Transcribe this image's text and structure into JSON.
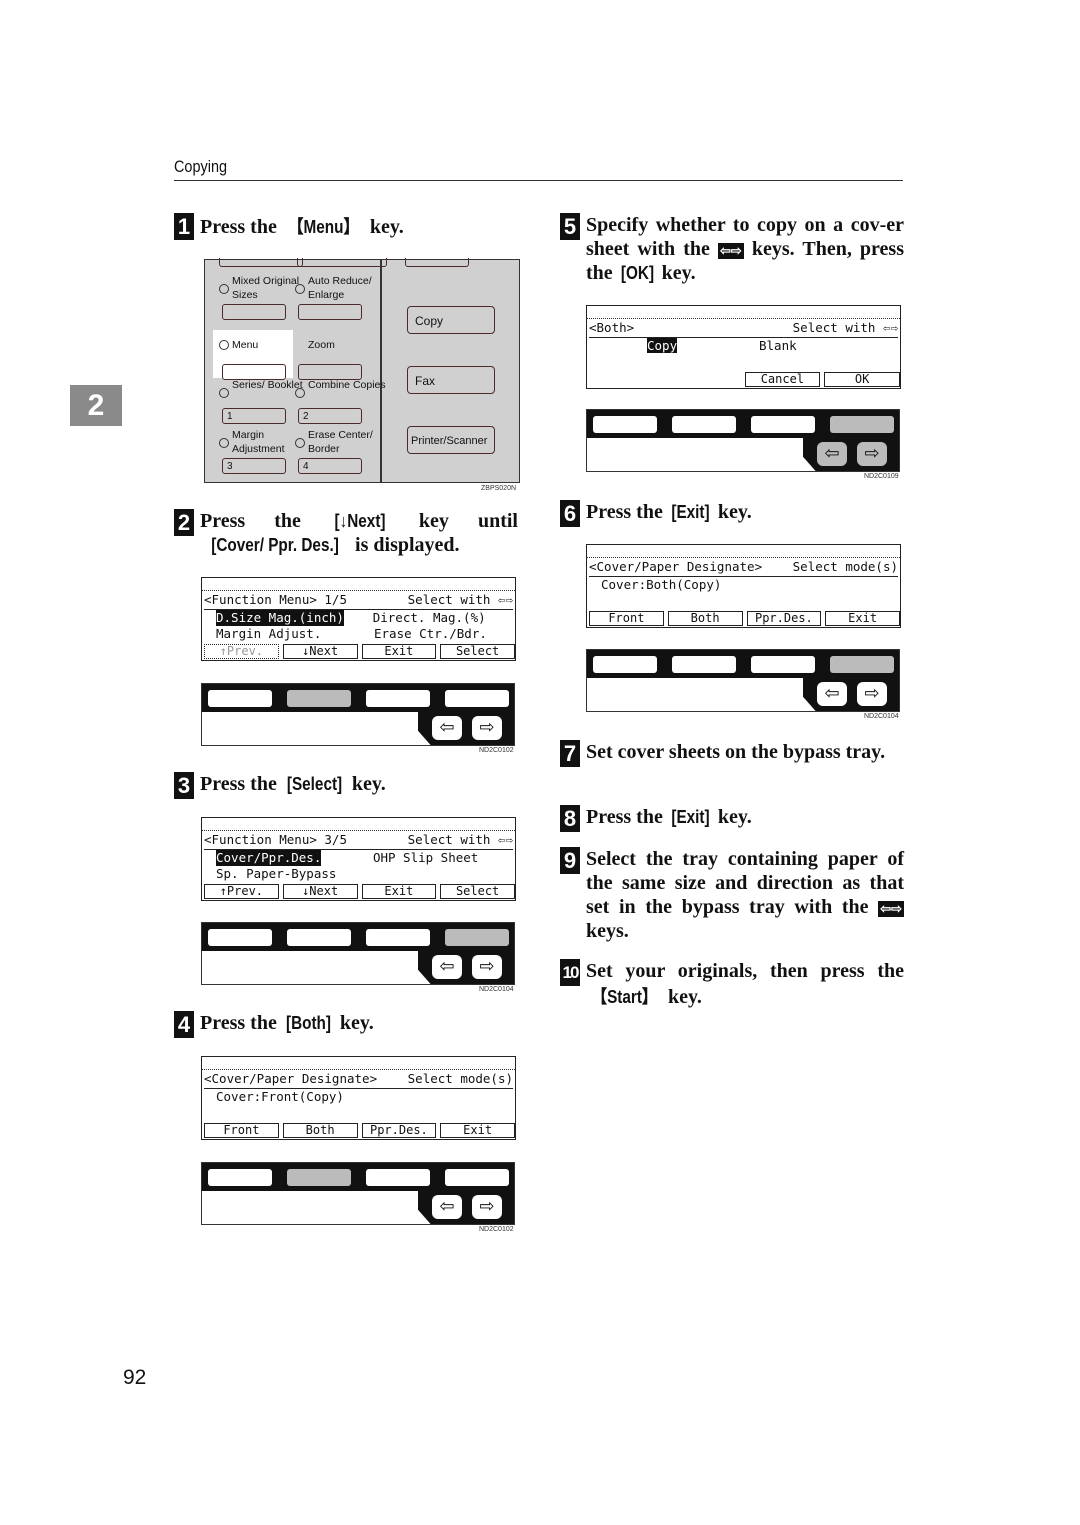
{
  "header": {
    "section": "Copying"
  },
  "chapter_tab": "2",
  "page_number": "92",
  "steps": [
    {
      "num": "1",
      "segments": [
        {
          "t": "Press the "
        },
        {
          "t": "【Menu】",
          "key": true
        },
        {
          "t": " key."
        }
      ]
    },
    {
      "num": "2",
      "segments": [
        {
          "t": "Press the "
        },
        {
          "t": "[↓Next]",
          "key": true
        },
        {
          "t": " key until "
        },
        {
          "t": "[Cover/ Ppr. Des.]",
          "key": true
        },
        {
          "t": " is displayed."
        }
      ]
    },
    {
      "num": "3",
      "segments": [
        {
          "t": "Press the "
        },
        {
          "t": "[Select]",
          "key": true
        },
        {
          "t": " key."
        }
      ]
    },
    {
      "num": "4",
      "segments": [
        {
          "t": "Press the "
        },
        {
          "t": "[Both]",
          "key": true
        },
        {
          "t": " key."
        }
      ]
    },
    {
      "num": "5",
      "segments": [
        {
          "t": "Specify whether to copy on a cov-er sheet with the "
        },
        {
          "t": "⇦⇨",
          "icon": true
        },
        {
          "t": " keys. Then, press the "
        },
        {
          "t": "[OK]",
          "key": true
        },
        {
          "t": " key."
        }
      ]
    },
    {
      "num": "6",
      "segments": [
        {
          "t": "Press the "
        },
        {
          "t": "[Exit]",
          "key": true
        },
        {
          "t": " key."
        }
      ]
    },
    {
      "num": "7",
      "segments": [
        {
          "t": "Set cover sheets on the bypass tray."
        }
      ]
    },
    {
      "num": "8",
      "segments": [
        {
          "t": "Press the "
        },
        {
          "t": "[Exit]",
          "key": true
        },
        {
          "t": " key."
        }
      ]
    },
    {
      "num": "9",
      "segments": [
        {
          "t": "Select the tray containing paper of the same size and direction as that set in the bypass tray with the "
        },
        {
          "t": "⇦⇨",
          "icon": true
        },
        {
          "t": " keys."
        }
      ]
    },
    {
      "num": "10",
      "segments": [
        {
          "t": "Set your originals, then press the "
        },
        {
          "t": "【Start】",
          "key": true
        },
        {
          "t": " key."
        }
      ]
    }
  ],
  "panel": {
    "buttons": [
      {
        "label": "Mixed Original Sizes"
      },
      {
        "label": "Auto Reduce/ Enlarge"
      },
      {
        "label": "Menu",
        "highlighted": true
      },
      {
        "label": "Zoom"
      },
      {
        "label": "Series/ Booklet",
        "key": "1"
      },
      {
        "label": "Combine Copies",
        "key": "2"
      },
      {
        "label": "Margin Adjustment",
        "key": "3"
      },
      {
        "label": "Erase Center/ Border",
        "key": "4"
      }
    ],
    "modes": [
      "Copy",
      "Fax",
      "Printer/Scanner"
    ],
    "code": "ZBPS020N"
  },
  "displays": [
    {
      "step": "2",
      "header_left": "<Function Menu> 1/5",
      "header_right": "Select with ⇦⇨",
      "rows": [
        [
          {
            "t": "D.Size Mag.(inch)",
            "hl": true
          },
          {
            "t": "Direct. Mag.(%)"
          }
        ],
        [
          {
            "t": "Margin Adjust."
          },
          {
            "t": "Erase Ctr./Bdr."
          }
        ]
      ],
      "softkeys": [
        {
          "t": "↑Prev.",
          "disabled": true
        },
        {
          "t": "↓Next"
        },
        {
          "t": "Exit"
        },
        {
          "t": "Select"
        }
      ],
      "keypad_active": 2,
      "arrows_active": false,
      "code": "ND2C0102"
    },
    {
      "step": "3",
      "header_left": "<Function Menu> 3/5",
      "header_right": "Select with ⇦⇨",
      "rows": [
        [
          {
            "t": "Cover/Ppr.Des.",
            "hl": true
          },
          {
            "t": "OHP Slip Sheet"
          }
        ],
        [
          {
            "t": "Sp. Paper-Bypass"
          }
        ]
      ],
      "softkeys": [
        {
          "t": "↑Prev."
        },
        {
          "t": "↓Next"
        },
        {
          "t": "Exit"
        },
        {
          "t": "Select"
        }
      ],
      "keypad_active": 4,
      "arrows_active": false,
      "code": "ND2C0104"
    },
    {
      "step": "4",
      "header_left": "<Cover/Paper Designate>",
      "header_right": "Select mode(s)",
      "rows": [
        [
          {
            "t": "Cover:Front(Copy)"
          }
        ]
      ],
      "softkeys": [
        {
          "t": "Front"
        },
        {
          "t": "Both"
        },
        {
          "t": "Ppr.Des."
        },
        {
          "t": "Exit"
        }
      ],
      "keypad_active": 2,
      "arrows_active": false,
      "code": "ND2C0102"
    },
    {
      "step": "5",
      "header_left": "<Both>",
      "header_right": "Select with ⇦⇨",
      "rows": [
        [
          {
            "t": "      Copy",
            "hlword": "Copy"
          },
          {
            "t": "Blank"
          }
        ]
      ],
      "softkeys": [
        {
          "t": "",
          "blank": true
        },
        {
          "t": "",
          "blank": true
        },
        {
          "t": "Cancel"
        },
        {
          "t": "OK"
        }
      ],
      "keypad_active": 4,
      "arrows_active": true,
      "code": "ND2C0109"
    },
    {
      "step": "6",
      "header_left": "<Cover/Paper Designate>",
      "header_right": "Select mode(s)",
      "rows": [
        [
          {
            "t": "Cover:Both(Copy)"
          }
        ]
      ],
      "softkeys": [
        {
          "t": "Front"
        },
        {
          "t": "Both"
        },
        {
          "t": "Ppr.Des."
        },
        {
          "t": "Exit"
        }
      ],
      "keypad_active": 4,
      "arrows_active": false,
      "code": "ND2C0104"
    }
  ]
}
